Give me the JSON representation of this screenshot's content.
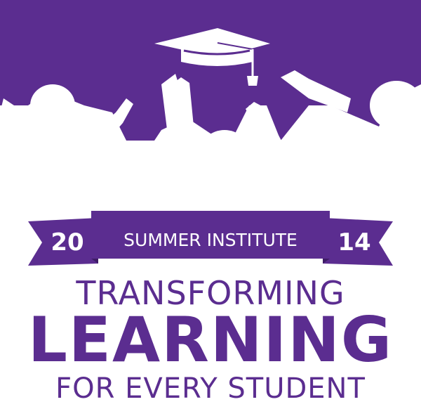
{
  "colors": {
    "purple": "#5b2d90",
    "white": "#ffffff"
  },
  "icons": {
    "cap": "graduation-cap-icon",
    "silhouettes": "cheering-students-silhouette"
  },
  "banner": {
    "year_left": "20",
    "title": "SUMMER INSTITUTE",
    "year_right": "14"
  },
  "tagline": {
    "line1": "TRANSFORMING",
    "line2": "LEARNING",
    "line3": "FOR EVERY STUDENT"
  }
}
